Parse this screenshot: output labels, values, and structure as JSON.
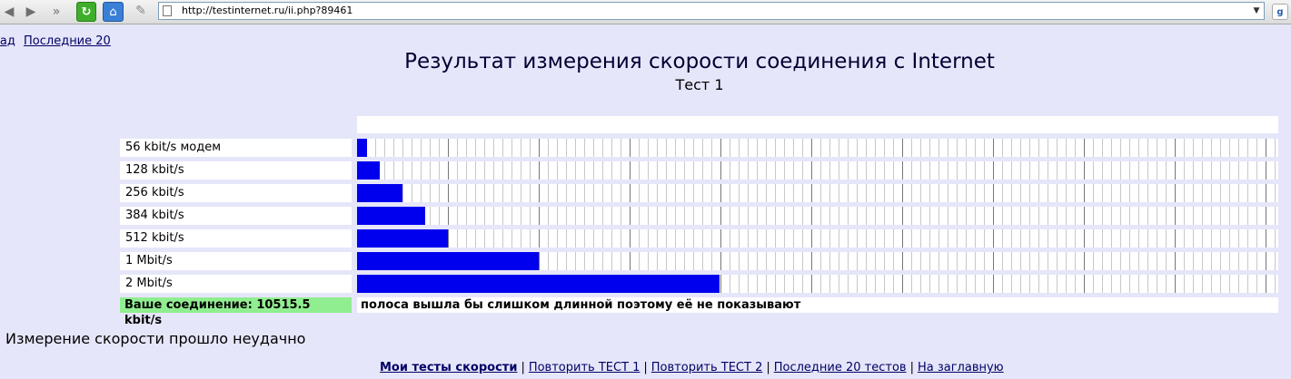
{
  "browser": {
    "url": "http://testinternet.ru/ii.php?89461"
  },
  "top_links": [
    {
      "label": "зад"
    },
    {
      "label": "Последние 20"
    }
  ],
  "page": {
    "title": "Результат измерения скорости соединения с Internet",
    "subtitle": "Тест 1",
    "status_message": "Измерение скорости прошло неудачно"
  },
  "chart_data": {
    "type": "bar",
    "orientation": "horizontal",
    "categories": [
      "56 kbit/s модем",
      "128 kbit/s",
      "256 kbit/s",
      "384 kbit/s",
      "512 kbit/s",
      "1 Mbit/s",
      "2 Mbit/s"
    ],
    "values": [
      56,
      128,
      256,
      384,
      512,
      1024,
      2048
    ],
    "units": "kbit/s",
    "xlim": [
      0,
      5200
    ],
    "result_label": "Ваше соединение: 10515.5 kbit/s",
    "result_value": 10515.5,
    "result_note": "полоса вышла бы слишком длинной поэтому её не показывают",
    "bar_color": "#0000ee",
    "result_color": "#90ee90"
  },
  "bottom_links": [
    {
      "label": "Мои тесты скорости",
      "bold": true
    },
    {
      "label": "Повторить ТЕСТ 1",
      "bold": false
    },
    {
      "label": "Повторить ТЕСТ 2",
      "bold": false
    },
    {
      "label": "Последние 20 тестов",
      "bold": false
    },
    {
      "label": "На заглавную",
      "bold": false
    }
  ]
}
